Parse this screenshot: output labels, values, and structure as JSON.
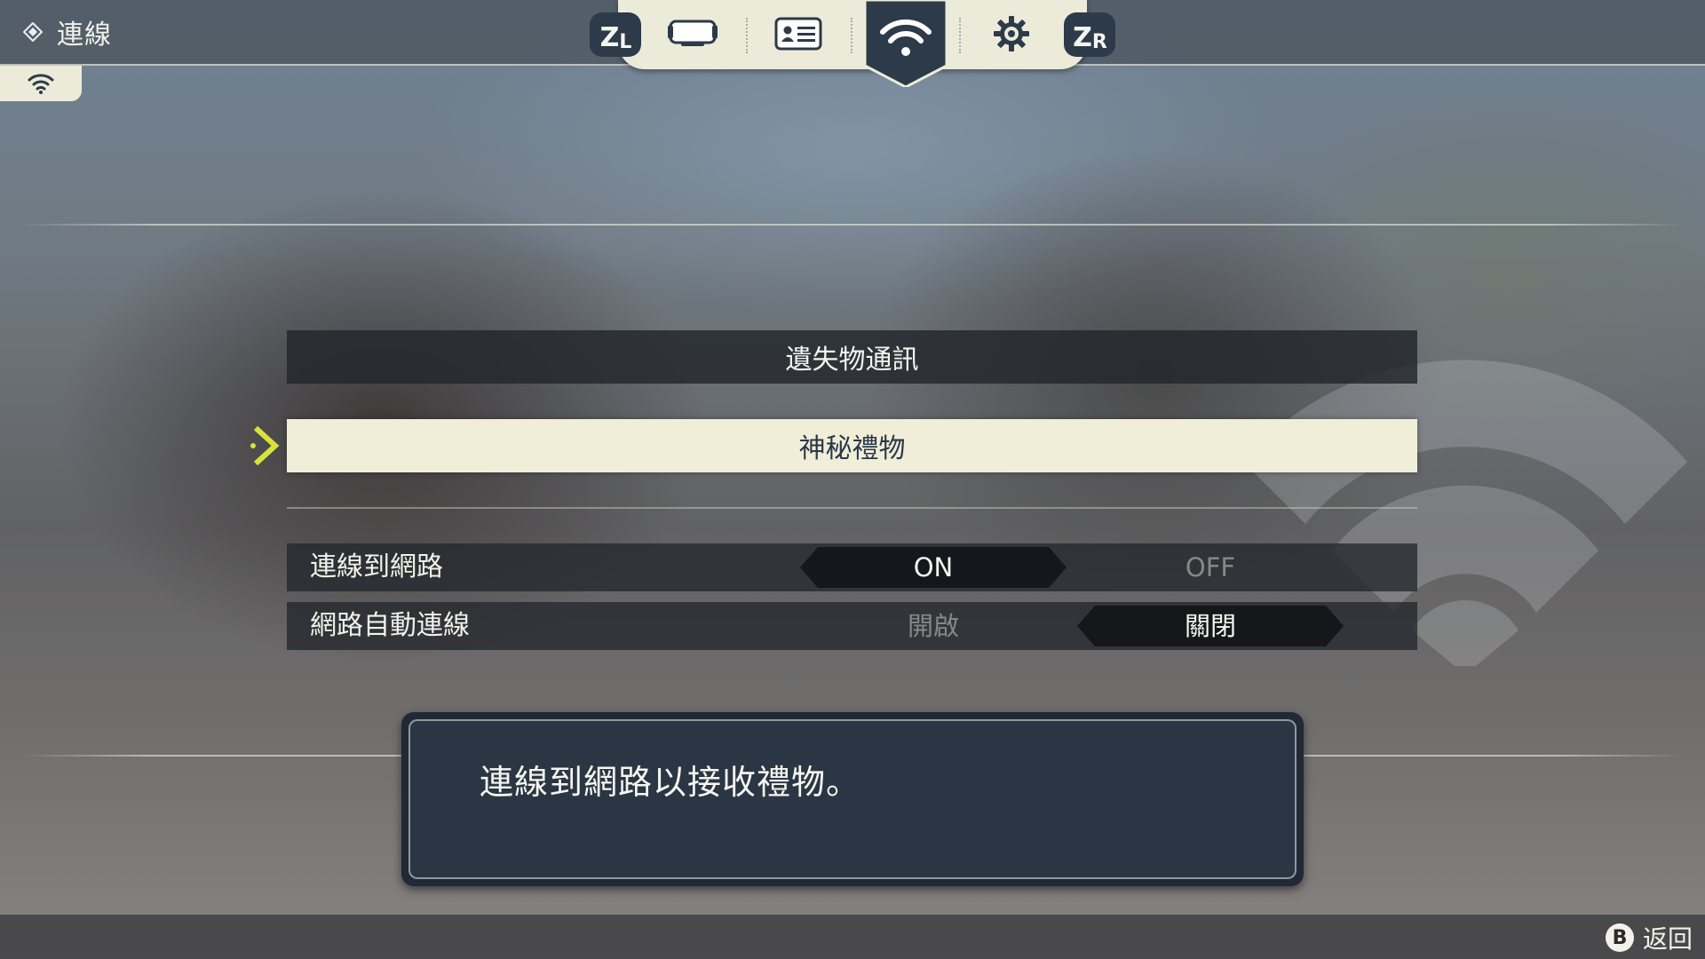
{
  "header": {
    "title": "連線",
    "shoulder_left": {
      "main": "Z",
      "sub": "L"
    },
    "shoulder_right": {
      "main": "Z",
      "sub": "R"
    },
    "tabs": [
      {
        "icon": "console-icon",
        "active": false
      },
      {
        "icon": "profile-card-icon",
        "active": false
      },
      {
        "icon": "wifi-icon",
        "active": true
      },
      {
        "icon": "gear-icon",
        "active": false
      }
    ],
    "side_tab_icon": "wifi-icon"
  },
  "menu": {
    "items": [
      {
        "label": "遺失物通訊",
        "selected": false
      },
      {
        "label": "神秘禮物",
        "selected": true
      }
    ]
  },
  "options": [
    {
      "label": "連線到網路",
      "choices": [
        "ON",
        "OFF"
      ],
      "selected": "ON"
    },
    {
      "label": "網路自動連線",
      "choices": [
        "開啟",
        "關閉"
      ],
      "selected": "關閉"
    }
  ],
  "description": "連線到網路以接收禮物。",
  "footer": {
    "button": "B",
    "label": "返回"
  },
  "colors": {
    "panel_cream": "#ecebd9",
    "navy": "#2c3a49",
    "cursor_yellow": "#d8e23a",
    "row_dark": "#22262c"
  }
}
